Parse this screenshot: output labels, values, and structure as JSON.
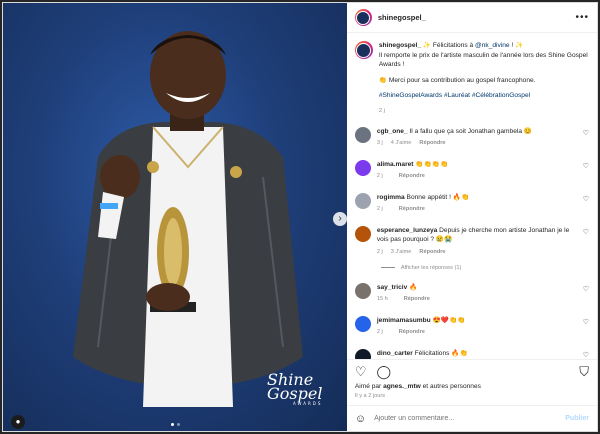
{
  "post": {
    "author": "shinegospel_",
    "caption_username": "shinegospel_",
    "caption_line1_pre": "✨ Félicitations à ",
    "caption_mention": "@nk_divine",
    "caption_line1_post": " ! ✨",
    "caption_line2": "Il remporte le prix de l'artiste masculin de l'année lors des Shine Gospel Awards !",
    "caption_line3": "👏 Merci pour sa contribution au gospel francophone.",
    "hashtags": "#ShineGospelAwards #Lauréat #CélébrationGospel",
    "caption_age": "2 j",
    "likes_text_pre": "Aimé par ",
    "likes_user": "agnes._mtw",
    "likes_text_post": " et autres personnes",
    "timestamp": "Il y a 2 jours",
    "comment_placeholder": "Ajouter un commentaire...",
    "publish_label": "Publier",
    "view_replies_label": "Afficher les réponses (1)",
    "watermark_line1": "Shine",
    "watermark_line2": "Gospel",
    "watermark_line3": "AWARDS",
    "next_icon": "chevron-right-icon"
  },
  "comments": [
    {
      "user": "cgb_one_",
      "text": "Il a fallu que ça soit Jonathan gambela 😊",
      "age": "3 j",
      "likes": "4 J'aime",
      "reply": "Répondre",
      "avatar": "#6b7280"
    },
    {
      "user": "alima.maret",
      "text": "👏👏👏👏",
      "age": "2 j",
      "likes": "",
      "reply": "Répondre",
      "avatar": "#7c3aed"
    },
    {
      "user": "rogimma",
      "text": "Bonne appétit ! 🔥👏",
      "age": "2 j",
      "likes": "",
      "reply": "Répondre",
      "avatar": "#9ca3af"
    },
    {
      "user": "esperance_lunzeya",
      "text": "Depuis je cherche mon artiste Jonathan je le vois pas pourquoi ? 😢😭",
      "age": "2 j",
      "likes": "3 J'aime",
      "reply": "Répondre",
      "avatar": "#b45309"
    },
    {
      "user": "say_triciv",
      "text": "🔥",
      "age": "15 h",
      "likes": "",
      "reply": "Répondre",
      "avatar": "#78716c"
    },
    {
      "user": "jemimamasumbu",
      "text": "😍❤️👏👏",
      "age": "2 j",
      "likes": "",
      "reply": "Répondre",
      "avatar": "#2563eb"
    },
    {
      "user": "dino_carter",
      "text": "Félicitations 🔥👏",
      "age": "",
      "likes": "",
      "reply": "",
      "avatar": "#111827"
    }
  ]
}
